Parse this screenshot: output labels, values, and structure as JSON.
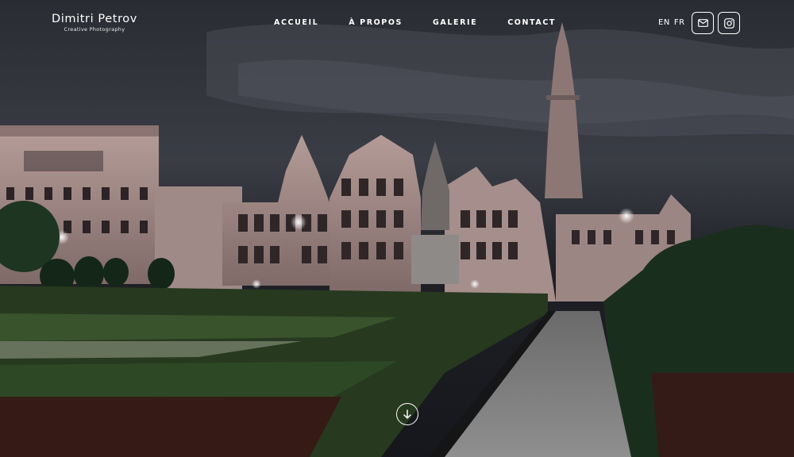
{
  "brand": {
    "name": "Dimitri Petrov",
    "tagline": "Creative Photography"
  },
  "nav": {
    "items": [
      {
        "label": "ACCUEIL"
      },
      {
        "label": "À PROPOS"
      },
      {
        "label": "GALERIE"
      },
      {
        "label": "CONTACT"
      }
    ]
  },
  "lang": {
    "en": "EN",
    "fr": "FR"
  },
  "social": {
    "mail_icon": "mail-icon",
    "instagram_icon": "instagram-icon"
  },
  "scroll": {
    "icon": "arrow-down-circle-icon"
  },
  "colors": {
    "text": "#ffffff",
    "sky": "#1a1c22",
    "buildings": "#a9908d",
    "hedge": "#263d28"
  }
}
